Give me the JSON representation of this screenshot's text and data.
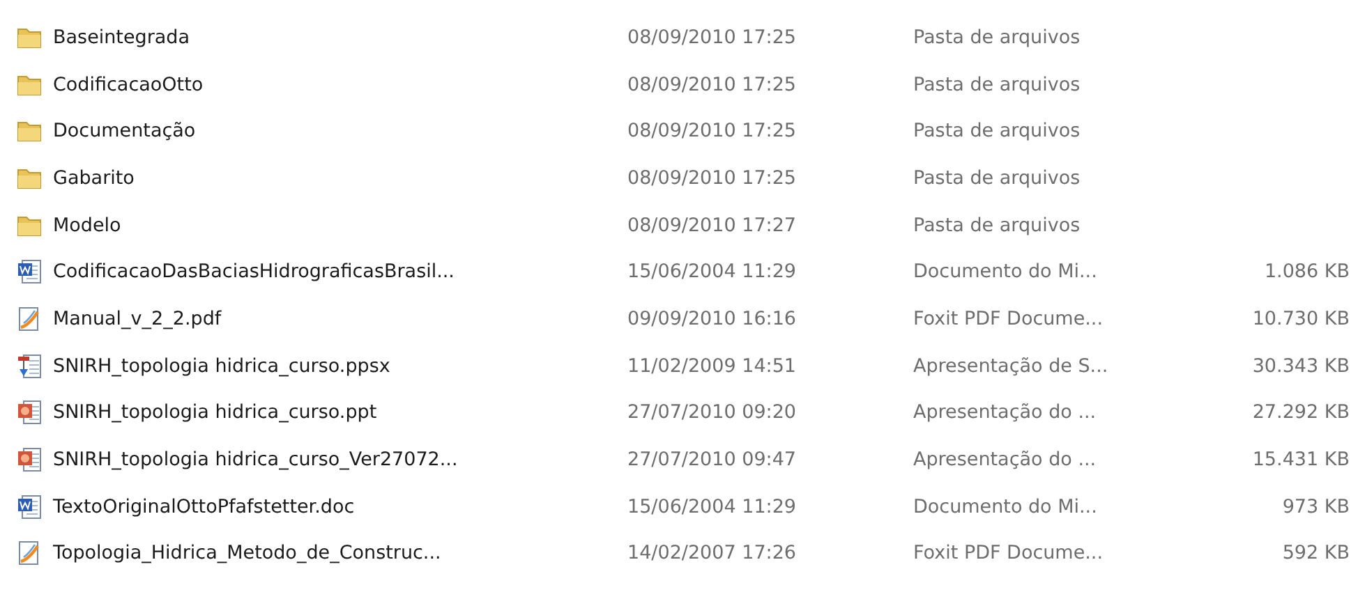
{
  "files": [
    {
      "kind": "folder",
      "name": "Baseintegrada",
      "date": "08/09/2010 17:25",
      "type": "Pasta de arquivos"
    },
    {
      "kind": "folder",
      "name": "CodificacaoOtto",
      "date": "08/09/2010 17:25",
      "type": "Pasta de arquivos"
    },
    {
      "kind": "folder",
      "name": "Documentação",
      "date": "08/09/2010 17:25",
      "type": "Pasta de arquivos"
    },
    {
      "kind": "folder",
      "name": "Gabarito",
      "date": "08/09/2010 17:25",
      "type": "Pasta de arquivos"
    },
    {
      "kind": "folder",
      "name": "Modelo",
      "date": "08/09/2010 17:27",
      "type": "Pasta de arquivos"
    },
    {
      "kind": "word",
      "name": "CodificacaoDasBaciasHidrograficasBrasil...",
      "date": "15/06/2004 11:29",
      "type": "Documento do Mi...",
      "size": "1.086 KB"
    },
    {
      "kind": "pdf",
      "name": "Manual_v_2_2.pdf",
      "date": "09/09/2010 16:16",
      "type": "Foxit PDF Docume...",
      "size": "10.730 KB"
    },
    {
      "kind": "slideshow",
      "name": "SNIRH_topologia hidrica_curso.ppsx",
      "date": "11/02/2009 14:51",
      "type": "Apresentação de S...",
      "size": "30.343 KB"
    },
    {
      "kind": "presentation",
      "name": "SNIRH_topologia hidrica_curso.ppt",
      "date": "27/07/2010 09:20",
      "type": "Apresentação do ...",
      "size": "27.292 KB"
    },
    {
      "kind": "presentation",
      "name": "SNIRH_topologia hidrica_curso_Ver27072...",
      "date": "27/07/2010 09:47",
      "type": "Apresentação do ...",
      "size": "15.431 KB"
    },
    {
      "kind": "word",
      "name": "TextoOriginalOttoPfafstetter.doc",
      "date": "15/06/2004 11:29",
      "type": "Documento do Mi...",
      "size": "973 KB"
    },
    {
      "kind": "pdf",
      "name": "Topologia_Hidrica_Metodo_de_Construc...",
      "date": "14/02/2007 17:26",
      "type": "Foxit PDF Docume...",
      "size": "592 KB"
    }
  ]
}
